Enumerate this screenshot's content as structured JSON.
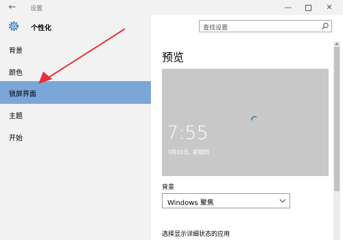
{
  "window": {
    "title": "设置"
  },
  "header": {
    "title": "个性化"
  },
  "search": {
    "placeholder": "查找设置"
  },
  "sidebar": {
    "items": [
      {
        "label": "背景"
      },
      {
        "label": "颜色"
      },
      {
        "label": "锁屏界面"
      },
      {
        "label": "主题"
      },
      {
        "label": "开始"
      }
    ]
  },
  "main": {
    "section_title": "预览",
    "preview": {
      "time": "7:55",
      "date": "3月10日, 星期四"
    },
    "background_label": "背景",
    "background_value": "Windows 聚焦",
    "status_label": "选择显示详细状态的应用"
  },
  "colors": {
    "selected": "#7aa7d8",
    "annotation_arrow": "#e8303a"
  }
}
